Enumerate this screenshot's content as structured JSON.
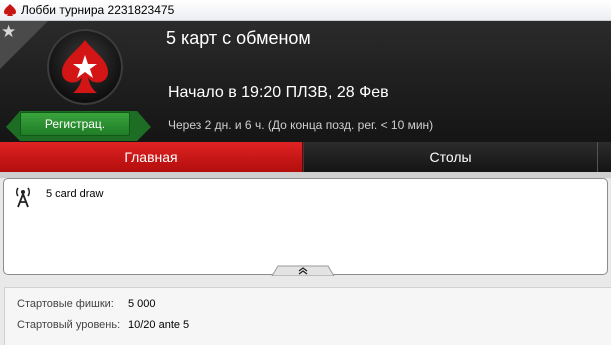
{
  "window": {
    "title": "Лобби турнира 2231823475"
  },
  "header": {
    "tournament_name": "5 карт с обменом",
    "start_time": "Начало в 19:20 ПЛЗВ, 28 Фев",
    "time_remaining": "Через 2 дн. и 6 ч. (До конца позд. рег. < 10 мин)",
    "register_label": "Регистрац."
  },
  "tabs": [
    {
      "label": "Главная",
      "active": true
    },
    {
      "label": "Столы",
      "active": false
    },
    {
      "label": "",
      "active": false
    }
  ],
  "description": {
    "game": "5 card draw"
  },
  "info": [
    {
      "label": "Стартовые фишки:",
      "value": "5 000"
    },
    {
      "label": "Стартовый уровень:",
      "value": "10/20 ante 5"
    }
  ],
  "colors": {
    "accent_red": "#c91414",
    "register_green": "#2a8f30",
    "header_bg": "#1f1f1f"
  }
}
